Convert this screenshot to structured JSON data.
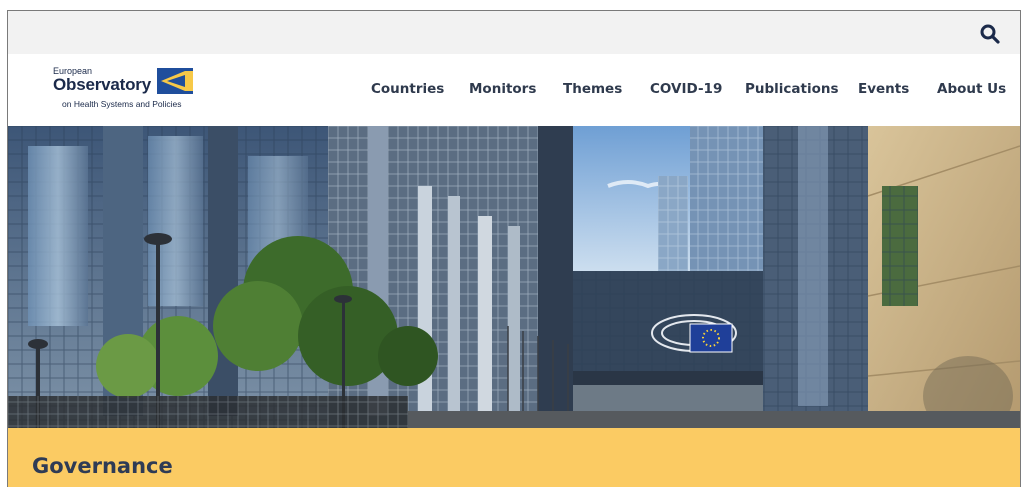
{
  "logo": {
    "line1": "European",
    "line2": "Observatory",
    "line3": "on Health Systems and Policies"
  },
  "nav": {
    "items": [
      {
        "label": "Countries"
      },
      {
        "label": "Monitors"
      },
      {
        "label": "Themes"
      },
      {
        "label": "COVID-19"
      },
      {
        "label": "Publications"
      },
      {
        "label": "Events"
      },
      {
        "label": "About Us"
      }
    ]
  },
  "hero": {
    "icon": "european-parliament-photo"
  },
  "page": {
    "title": "Governance"
  },
  "colors": {
    "brand_navy": "#1b2a4a",
    "accent_yellow": "#fbcb63",
    "logo_blue": "#1f4e9c"
  }
}
